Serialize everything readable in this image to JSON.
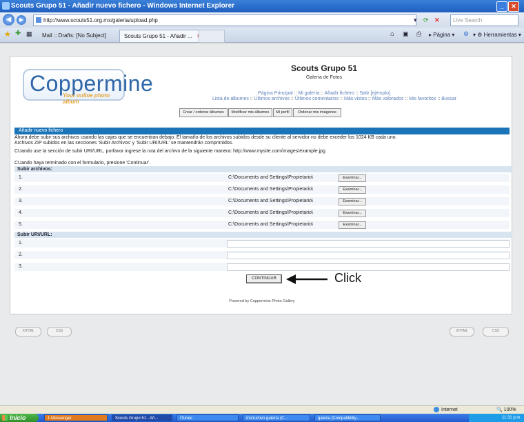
{
  "window": {
    "title": "Scouts Grupo 51 - Añadir nuevo fichero - Windows Internet Explorer"
  },
  "addressbar": {
    "url": "http://www.scouts51.org.mx/galeria/upload.php",
    "search_placeholder": "Live Search"
  },
  "tabs": [
    {
      "label": "Mail :: Drafts: [No Subject]"
    },
    {
      "label": "Scouts Grupo 51 - Añadir ..."
    }
  ],
  "commandbar": {
    "page_label": "Página",
    "tools_label": "Herramientas"
  },
  "site": {
    "logo": "Coppermine",
    "logo_tagline": "Your online photo album",
    "title": "Scouts Grupo 51",
    "subtitle": "Galería de Fotos",
    "nav1": [
      "Página Principal",
      "Mi galería",
      "Añadir fichero",
      "Salir [ejemplo]"
    ],
    "nav2": [
      "Lista de álbumes",
      "Últimos archivos",
      "Últimos comentarios",
      "Más vistos",
      "Más valorados",
      "Mis favoritos",
      "Buscar"
    ],
    "sub_buttons": [
      "Crear / ordenar álbumes",
      "Modificar mis álbumes",
      "Mi perfil",
      "Ordenar mis imágenes"
    ]
  },
  "form": {
    "header": "Añadir nuevo fichero",
    "intro1": "Ahora debe subir sus archivos usando las cajas que se encuentran debajo. El tamaño de los archivos subidos desde su cliente al servidor no debe exceder los 1024 KB cada uno.",
    "intro2": "Archivos ZIP subidos en las secciones 'Subir Archivos' y 'Subir URI/URL' se mantendrán comprimidos.",
    "intro3": "CUando use la sección de subir URI/URL, porfavor ingrese la ruta del archivo de la siguiente manera: http://www.mysite.com/images/example.jpg",
    "intro4": "CUando haya terminado con el formulario, presione 'Continuar'.",
    "files_label": "Subir archivos:",
    "file_rows": [
      {
        "num": "1.",
        "path": "C:\\Documents and Settings\\Propietario\\"
      },
      {
        "num": "2.",
        "path": "C:\\Documents and Settings\\Propietario\\"
      },
      {
        "num": "3.",
        "path": "C:\\Documents and Settings\\Propietario\\"
      },
      {
        "num": "4.",
        "path": "C:\\Documents and Settings\\Propietario\\"
      },
      {
        "num": "5.",
        "path": "C:\\Documents and Settings\\Propietario\\"
      }
    ],
    "browse_label": "Examinar...",
    "url_label": "Subir URI/URL:",
    "url_rows": [
      "1.",
      "2.",
      "3."
    ],
    "continue_label": "CONTINUAR",
    "click_annotation": "Click",
    "powered_by": "Powered by Coppermine Photo Gallery"
  },
  "badges": [
    "XHTML",
    "CSS"
  ],
  "statusbar": {
    "zone": "Internet",
    "zoom": "100%"
  },
  "taskbar": {
    "start": "Inicio",
    "tasks": [
      "1 Messenger",
      "Scouts Grupo 51 - Añ...",
      "iTunes",
      "Instructivo galería (C...",
      "galeria [Compatibility..."
    ],
    "clock": "11:31 p.m."
  }
}
